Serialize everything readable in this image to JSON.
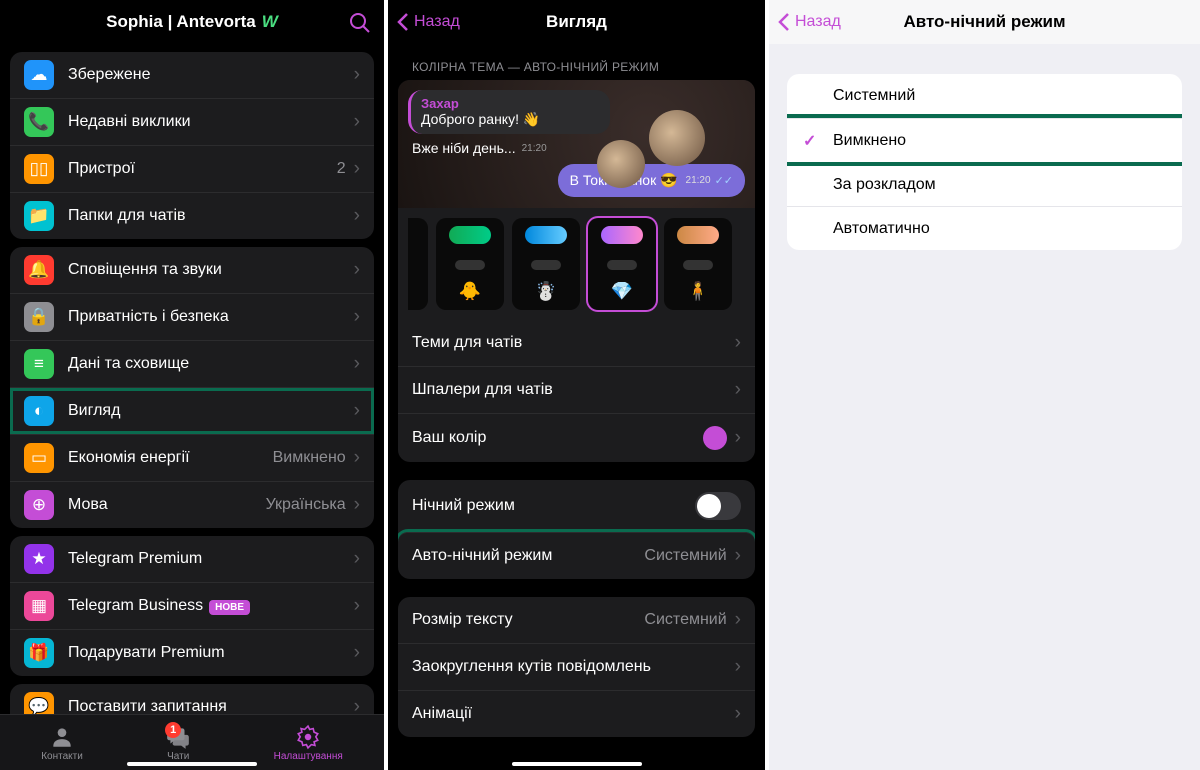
{
  "screen1": {
    "header_title": "Sophia | Antevorta",
    "groups": [
      {
        "rows": [
          {
            "icon": "ic-saved",
            "glyph": "☁",
            "label": "Збережене"
          },
          {
            "icon": "ic-calls",
            "glyph": "📞",
            "label": "Недавні виклики"
          },
          {
            "icon": "ic-devices",
            "glyph": "▯▯",
            "label": "Пристрої",
            "detail": "2"
          },
          {
            "icon": "ic-folders",
            "glyph": "📁",
            "label": "Папки для чатів"
          }
        ]
      },
      {
        "rows": [
          {
            "icon": "ic-notif",
            "glyph": "🔔",
            "label": "Сповіщення та звуки"
          },
          {
            "icon": "ic-privacy",
            "glyph": "🔒",
            "label": "Приватність і безпека"
          },
          {
            "icon": "ic-data",
            "glyph": "≡",
            "label": "Дані та сховище"
          },
          {
            "icon": "ic-appearance",
            "glyph": "◐",
            "label": "Вигляд",
            "highlight": true
          },
          {
            "icon": "ic-energy",
            "glyph": "▭",
            "label": "Економія енергії",
            "detail": "Вимкнено"
          },
          {
            "icon": "ic-lang",
            "glyph": "⊕",
            "label": "Мова",
            "detail": "Українська"
          }
        ]
      },
      {
        "rows": [
          {
            "icon": "ic-premium",
            "glyph": "★",
            "label": "Telegram Premium"
          },
          {
            "icon": "ic-business",
            "glyph": "▦",
            "label": "Telegram Business",
            "badge": "НОВЕ"
          },
          {
            "icon": "ic-gift",
            "glyph": "🎁",
            "label": "Подарувати Premium"
          }
        ]
      },
      {
        "rows": [
          {
            "icon": "ic-question",
            "glyph": "💬",
            "label": "Поставити запитання"
          }
        ]
      }
    ],
    "tabs": {
      "contacts": "Контакти",
      "chats": "Чати",
      "chats_badge": "1",
      "settings": "Налаштування"
    }
  },
  "screen2": {
    "back": "Назад",
    "title": "Вигляд",
    "section_caption": "КОЛІРНА ТЕМА — АВТО-НІЧНИЙ РЕЖИМ",
    "preview": {
      "sender": "Захар",
      "in_text": "Доброго ранку! 👋",
      "loose_text": "Вже ніби день...",
      "loose_time": "21:20",
      "out_text": "В Токіо ранок 😎",
      "out_time": "21:20"
    },
    "themes_emoji": [
      "🐥",
      "☃️",
      "💎",
      "🧍"
    ],
    "appearance_rows": [
      {
        "label": "Теми для чатів"
      },
      {
        "label": "Шпалери для чатів"
      },
      {
        "label": "Ваш колір",
        "color": true
      }
    ],
    "night_rows": [
      {
        "label": "Нічний режим",
        "toggle": true
      },
      {
        "label": "Авто-нічний режим",
        "detail": "Системний",
        "highlight": true
      }
    ],
    "text_rows": [
      {
        "label": "Розмір тексту",
        "detail": "Системний"
      },
      {
        "label": "Заокруглення кутів повідомлень"
      },
      {
        "label": "Анімації"
      }
    ]
  },
  "screen3": {
    "back": "Назад",
    "title": "Авто-нічний режим",
    "options": [
      {
        "label": "Системний"
      },
      {
        "label": "Вимкнено",
        "selected": true,
        "highlight": true
      },
      {
        "label": "За розкладом"
      },
      {
        "label": "Автоматично"
      }
    ]
  }
}
